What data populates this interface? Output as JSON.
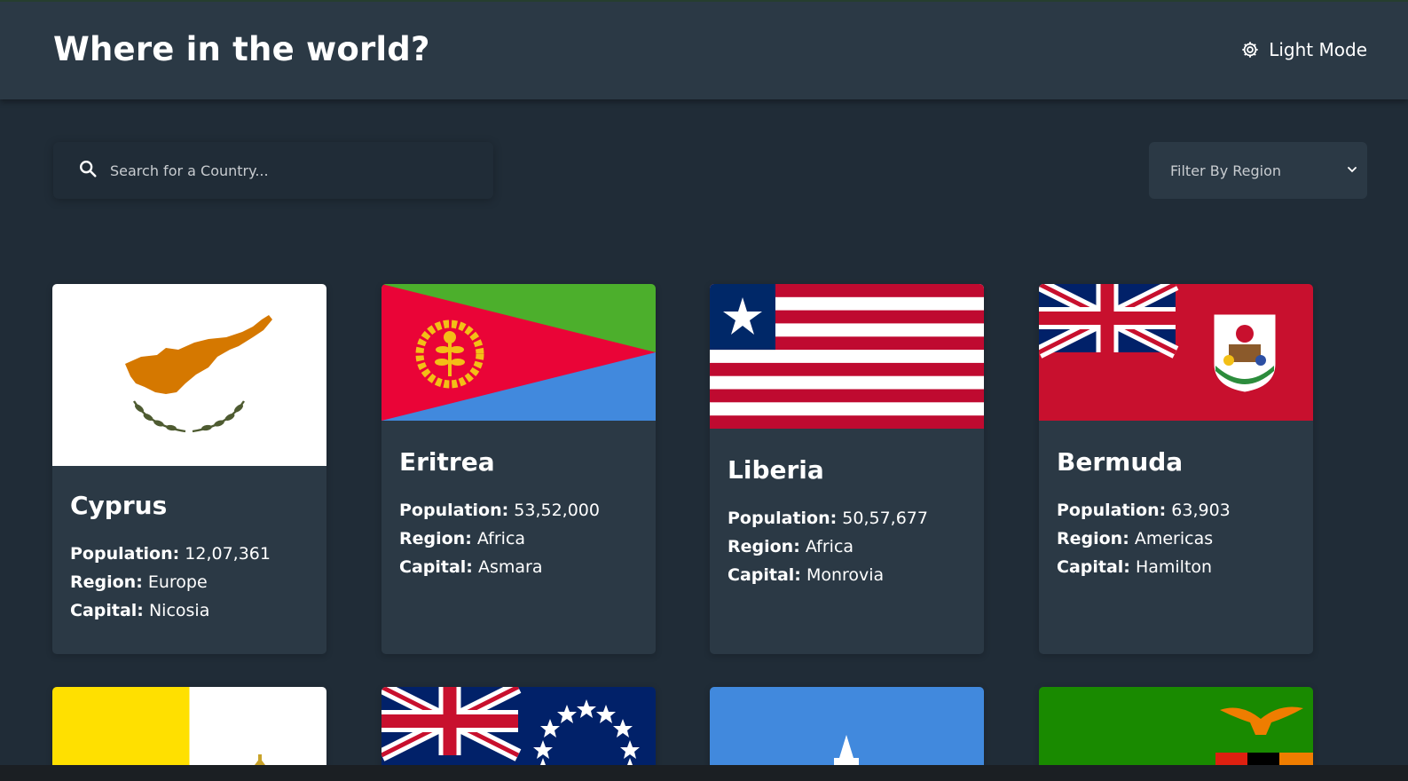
{
  "header": {
    "title": "Where in the world?",
    "mode_toggle_label": "Light Mode",
    "mode_icon": "gear-icon"
  },
  "search": {
    "placeholder": "Search for a Country...",
    "value": "",
    "icon": "search-icon"
  },
  "filter": {
    "selected_label": "Filter By Region",
    "icon": "chevron-down-icon"
  },
  "labels": {
    "population": "Population:",
    "region": "Region:",
    "capital": "Capital:"
  },
  "countries": [
    {
      "name": "Cyprus",
      "population": "12,07,361",
      "region": "Europe",
      "capital": "Nicosia"
    },
    {
      "name": "Eritrea",
      "population": "53,52,000",
      "region": "Africa",
      "capital": "Asmara"
    },
    {
      "name": "Liberia",
      "population": "50,57,677",
      "region": "Africa",
      "capital": "Monrovia"
    },
    {
      "name": "Bermuda",
      "population": "63,903",
      "region": "Americas",
      "capital": "Hamilton"
    }
  ],
  "colors": {
    "background": "#202c37",
    "element": "#2b3945",
    "text": "#ffffff"
  }
}
